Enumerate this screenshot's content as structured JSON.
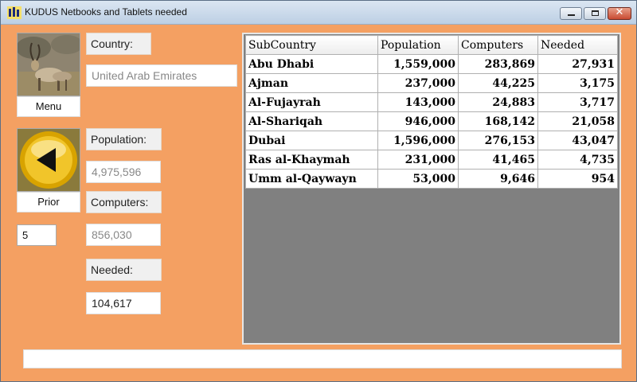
{
  "window": {
    "title": "KUDUS Netbooks and Tablets needed"
  },
  "nav": {
    "menu_label": "Menu",
    "prior_label": "Prior",
    "page_value": "5"
  },
  "fields": {
    "country_label": "Country:",
    "country_value": "United Arab Emirates",
    "population_label": "Population:",
    "population_value": "4,975,596",
    "computers_label": "Computers:",
    "computers_value": "856,030",
    "needed_label": "Needed:",
    "needed_value": "104,617"
  },
  "table": {
    "headers": [
      "SubCountry",
      "Population",
      "Computers",
      "Needed"
    ],
    "rows": [
      [
        "Abu Dhabi",
        "1,559,000",
        "283,869",
        "27,931"
      ],
      [
        "Ajman",
        "237,000",
        "44,225",
        "3,175"
      ],
      [
        "Al-Fujayrah",
        "143,000",
        "24,883",
        "3,717"
      ],
      [
        "Al-Shariqah",
        "946,000",
        "168,142",
        "21,058"
      ],
      [
        "Dubai",
        "1,596,000",
        "276,153",
        "43,047"
      ],
      [
        "Ras al-Khaymah",
        "231,000",
        "41,465",
        "4,735"
      ],
      [
        "Umm al-Qaywayn",
        "53,000",
        "9,646",
        "954"
      ]
    ]
  },
  "status_bar": {
    "text": ""
  },
  "icons": {
    "menu_image": "kudu-antelope-image",
    "prior_image": "gold-back-arrow-icon",
    "app_icon": "kudus-app-icon"
  },
  "colors": {
    "background": "#f4a062",
    "grid_empty": "#808080"
  }
}
